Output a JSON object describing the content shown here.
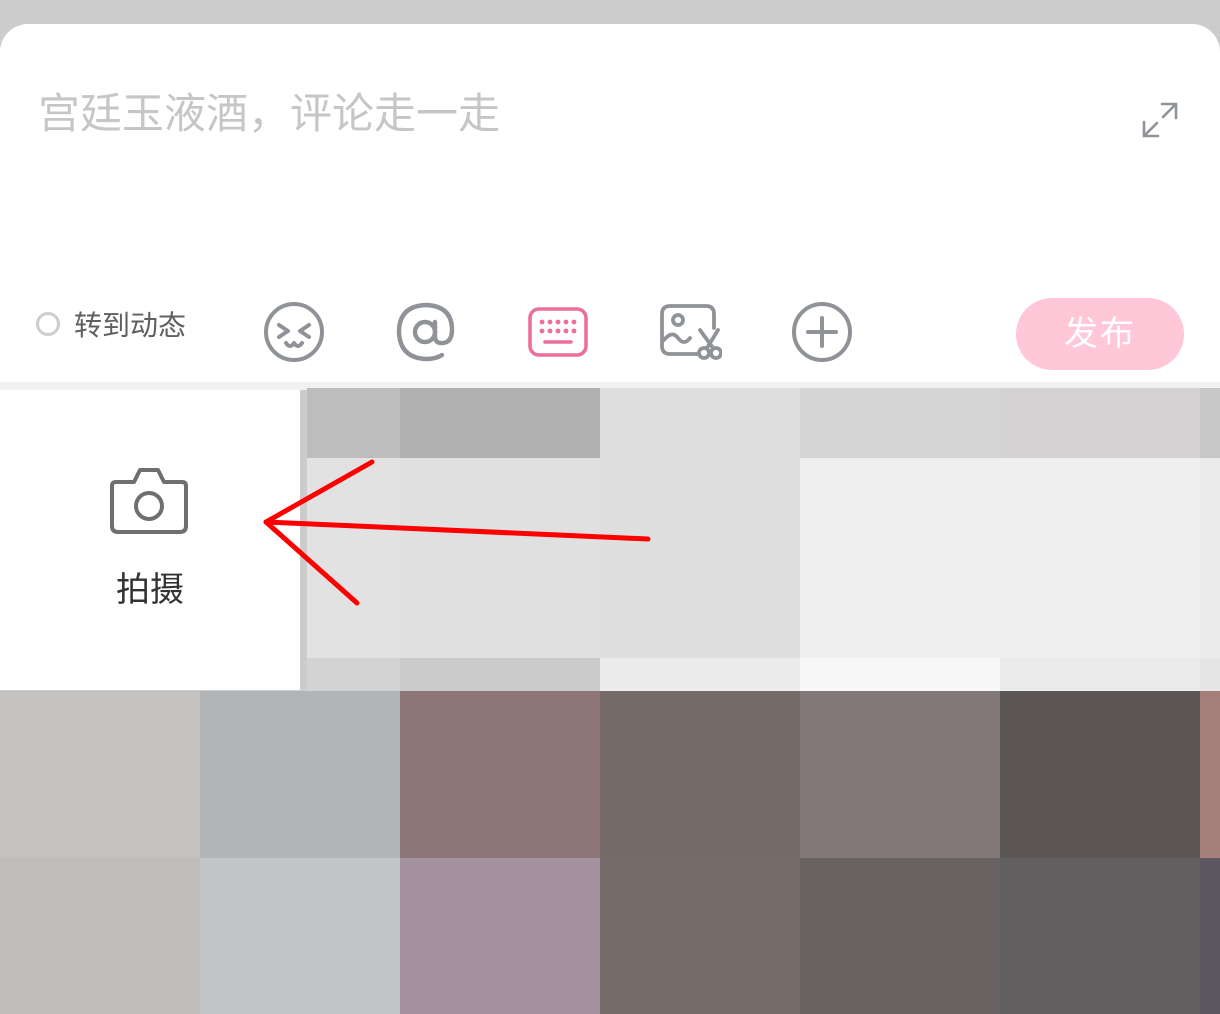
{
  "composer": {
    "placeholder": "宫廷玉液酒，评论走一走",
    "expand_icon": "expand-icon"
  },
  "toolbar": {
    "repost_label": "转到动态",
    "repost_checked": false,
    "tools": [
      "emoji-icon",
      "mention-icon",
      "keyboard-icon",
      "image-edit-icon",
      "plus-circle-icon"
    ],
    "publish_label": "发布",
    "publish_enabled": false
  },
  "picker": {
    "camera_label": "拍摄",
    "camera_icon": "camera-icon"
  },
  "colors": {
    "accent": "#ec6f97",
    "publish_disabled": "#ffc7d8",
    "icon_gray": "#8f9297",
    "annotation_arrow": "#ff0000"
  }
}
